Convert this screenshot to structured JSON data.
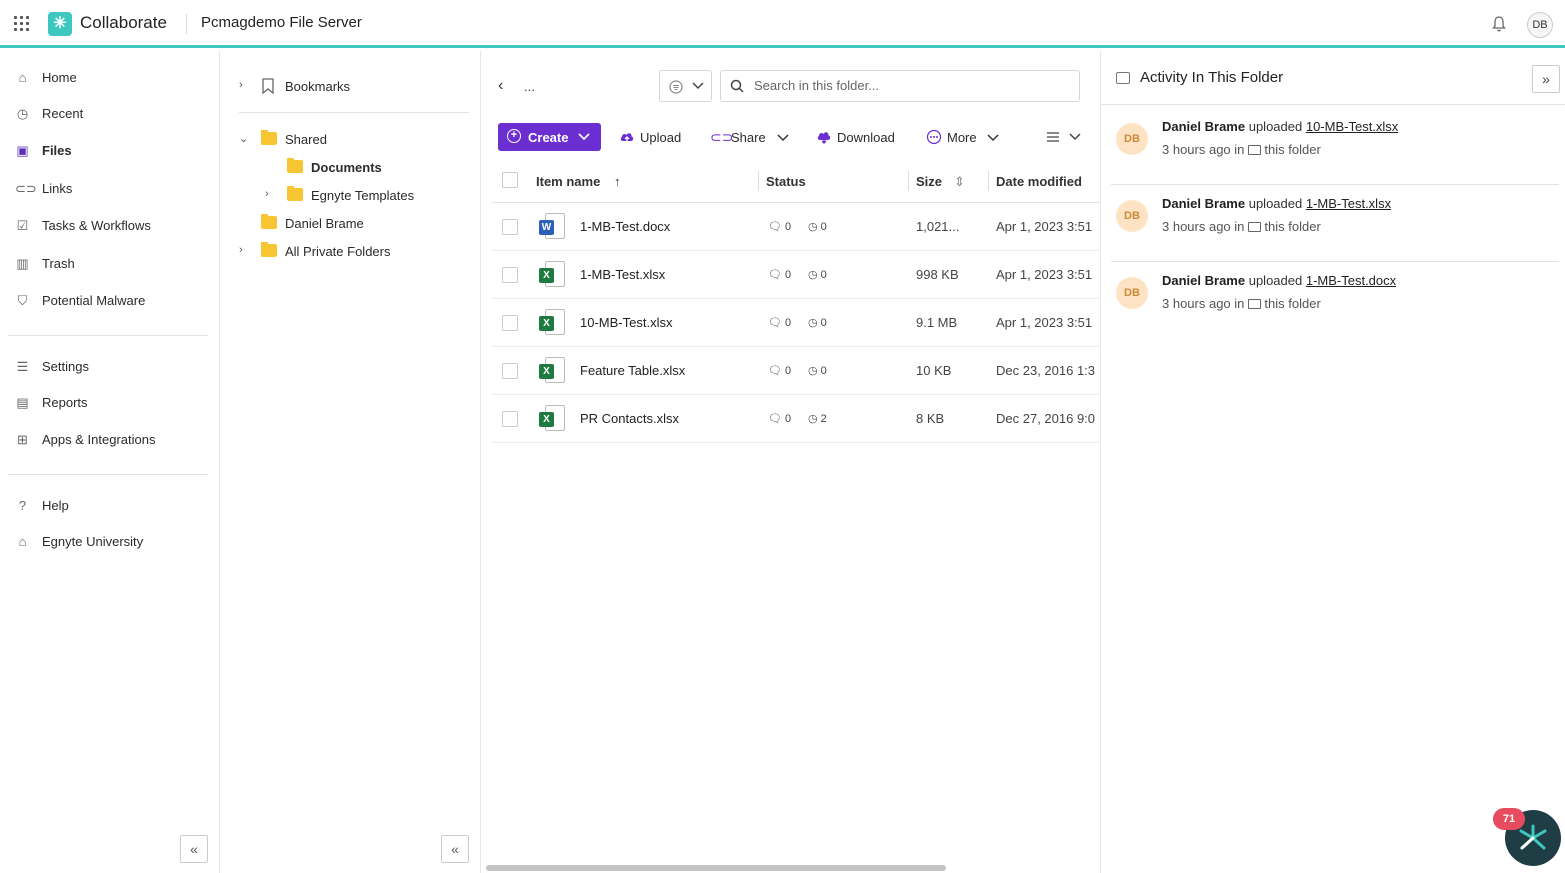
{
  "topbar": {
    "app_name": "Collaborate",
    "server_name": "Pcmagdemo File Server",
    "user_initials": "DB",
    "accent_color": "#3ec7be"
  },
  "nav": {
    "items": [
      {
        "label": "Home",
        "icon": "home-icon"
      },
      {
        "label": "Recent",
        "icon": "clock-icon"
      },
      {
        "label": "Files",
        "icon": "files-icon"
      },
      {
        "label": "Links",
        "icon": "link-icon"
      },
      {
        "label": "Tasks & Workflows",
        "icon": "clipboard-icon"
      },
      {
        "label": "Trash",
        "icon": "trash-icon"
      },
      {
        "label": "Potential Malware",
        "icon": "shield-icon"
      },
      {
        "label": "Settings",
        "icon": "sliders-icon"
      },
      {
        "label": "Reports",
        "icon": "report-icon"
      },
      {
        "label": "Apps & Integrations",
        "icon": "apps-icon"
      },
      {
        "label": "Help",
        "icon": "help-icon"
      },
      {
        "label": "Egnyte University",
        "icon": "graduation-icon"
      }
    ],
    "active": "Files"
  },
  "tree": {
    "bookmarks": "Bookmarks",
    "shared": "Shared",
    "documents": "Documents",
    "templates": "Egnyte Templates",
    "daniel": "Daniel Brame",
    "private": "All Private Folders"
  },
  "main": {
    "breadcrumb": "...",
    "search_placeholder": "Search in this folder...",
    "toolbar": {
      "create": "Create",
      "upload": "Upload",
      "share": "Share",
      "download": "Download",
      "more": "More"
    },
    "columns": {
      "name": "Item name",
      "status": "Status",
      "size": "Size",
      "date": "Date modified"
    },
    "files": [
      {
        "name": "1-MB-Test.docx",
        "type": "W",
        "comments": "0",
        "versions": "0",
        "size": "1,021...",
        "date": "Apr 1, 2023 3:51"
      },
      {
        "name": "1-MB-Test.xlsx",
        "type": "X",
        "comments": "0",
        "versions": "0",
        "size": "998 KB",
        "date": "Apr 1, 2023 3:51"
      },
      {
        "name": "10-MB-Test.xlsx",
        "type": "X",
        "comments": "0",
        "versions": "0",
        "size": "9.1 MB",
        "date": "Apr 1, 2023 3:51"
      },
      {
        "name": "Feature Table.xlsx",
        "type": "X",
        "comments": "0",
        "versions": "0",
        "size": "10 KB",
        "date": "Dec 23, 2016 1:3"
      },
      {
        "name": "PR Contacts.xlsx",
        "type": "X",
        "comments": "0",
        "versions": "2",
        "size": "8 KB",
        "date": "Dec 27, 2016 9:0"
      }
    ]
  },
  "activity": {
    "title": "Activity In This Folder",
    "items": [
      {
        "initials": "DB",
        "user": "Daniel Brame",
        "action": "uploaded",
        "file": "10-MB-Test.xlsx",
        "time": "3 hours ago in",
        "where": "this folder"
      },
      {
        "initials": "DB",
        "user": "Daniel Brame",
        "action": "uploaded",
        "file": "1-MB-Test.xlsx",
        "time": "3 hours ago in",
        "where": "this folder"
      },
      {
        "initials": "DB",
        "user": "Daniel Brame",
        "action": "uploaded",
        "file": "1-MB-Test.docx",
        "time": "3 hours ago in",
        "where": "this folder"
      }
    ]
  },
  "chat": {
    "badge": "71"
  }
}
